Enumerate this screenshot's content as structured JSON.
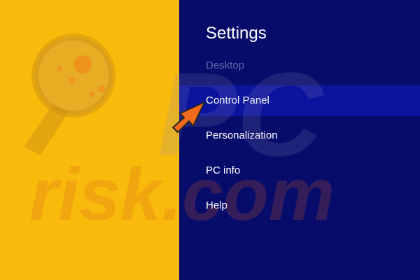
{
  "settings_charm": {
    "title": "Settings",
    "items": [
      {
        "label": "Desktop",
        "state": "disabled"
      },
      {
        "label": "Control Panel",
        "state": "selected"
      },
      {
        "label": "Personalization",
        "state": "normal"
      },
      {
        "label": "PC info",
        "state": "normal"
      },
      {
        "label": "Help",
        "state": "normal"
      }
    ]
  },
  "watermark": {
    "logo_text": "PC",
    "site_text": "risk.com"
  },
  "colors": {
    "left_background": "#f9bb0b",
    "charm_background": "#070c6b",
    "selected_item": "#0b149e",
    "disabled_text": "#5f63a8",
    "pointer_arrow": "#f26a1c"
  },
  "annotation": {
    "icon": "orange-pointer-arrow-icon"
  }
}
